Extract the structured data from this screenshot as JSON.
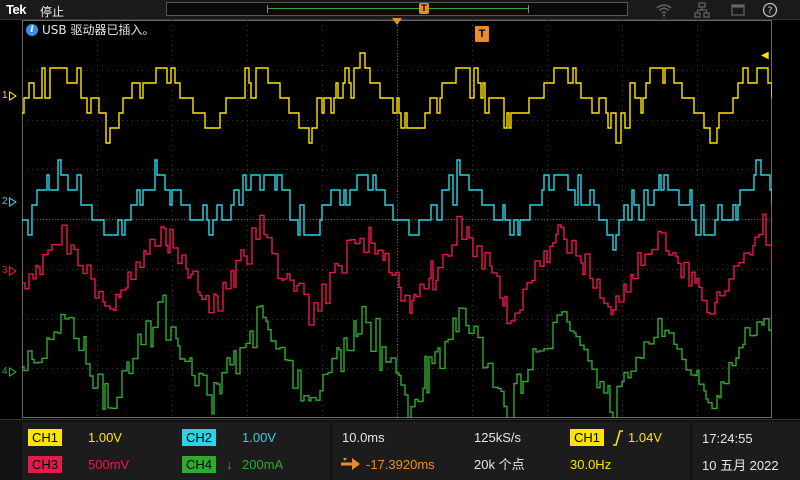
{
  "topbar": {
    "brand": "Tek",
    "run_state": "停止",
    "trigger_position_marker": "T"
  },
  "message": {
    "icon": "info-icon",
    "text": "USB 驱动器已插入。"
  },
  "graticule": {
    "trigger_marker": "T",
    "channel_markers": [
      {
        "label": "1",
        "color": "#ffe400"
      },
      {
        "label": "2",
        "color": "#2ad4e4"
      },
      {
        "label": "3",
        "color": "#e6194b"
      },
      {
        "label": "4",
        "color": "#2faa2f"
      }
    ]
  },
  "channels": [
    {
      "name": "CH1",
      "scale": "1.00V",
      "color": "#ffe400",
      "coupling": ""
    },
    {
      "name": "CH2",
      "scale": "1.00V",
      "color": "#2ad4e4",
      "coupling": ""
    },
    {
      "name": "CH3",
      "scale": "500mV",
      "color": "#e6194b",
      "coupling": ""
    },
    {
      "name": "CH4",
      "scale": "200mA",
      "color": "#2faa2f",
      "coupling": "↓"
    }
  ],
  "horizontal": {
    "time_per_div": "10.0ms",
    "sample_rate": "125kS/s",
    "delay": "-17.3920ms",
    "record_length": "20k 个点"
  },
  "trigger": {
    "source": "CH1",
    "slope_icon": "rising-edge-icon",
    "level": "1.04V",
    "frequency": "30.0Hz"
  },
  "clock": {
    "time": "17:24:55",
    "date": "10 五月 2022"
  }
}
